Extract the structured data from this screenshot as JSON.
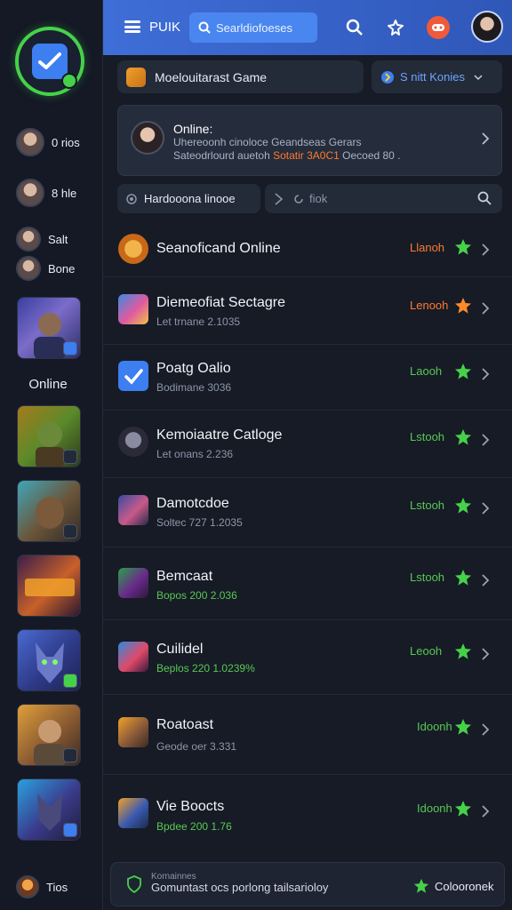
{
  "app": {
    "brand": "PUIK"
  },
  "colors": {
    "accent": "#3f6ed8",
    "online_green": "#46d14a",
    "live_orange": "#ff7a2e",
    "panel": "#232a38"
  },
  "search": {
    "placeholder": "Searldiofoeses"
  },
  "top_icons": [
    "search-icon",
    "puzzle-icon",
    "game-badge-icon"
  ],
  "sidebar": {
    "contacts": [
      {
        "label": "0 rios"
      },
      {
        "label": "8 hle"
      },
      {
        "label": "Salt"
      },
      {
        "label": "Bone"
      }
    ],
    "online_label": "Online",
    "footer_label": "Tios"
  },
  "filters": {
    "category": "Moelouitarast Game",
    "mode": "S nitt Konies",
    "secondary": "Hardooona linooe",
    "search_placeholder": "fiok"
  },
  "feature": {
    "title": "Online:",
    "desc": "Uhereoonh cinoloce Geandseas Gerars",
    "meta_prefix": "Sateodrlourd auetoh ",
    "meta_highlight": "Sotatir 3A0C1",
    "meta_suffix": " Oecoed 80 ."
  },
  "games": [
    {
      "title": "Seanoficand Online",
      "sub": "",
      "status": "Llanoh",
      "status_color": "#ff7a2e",
      "star_color": "#46d14a"
    },
    {
      "title": "Diemeofiat Sectagre",
      "sub": "Let trnane 2.1035",
      "status": "Lenooh",
      "status_color": "#ff7a2e",
      "star_color": "#ff8a2a"
    },
    {
      "title": "Poatg Oalio",
      "sub": "Bodimane 3036",
      "status": "Laooh",
      "status_color": "#59c853",
      "star_color": "#46d14a"
    },
    {
      "title": "Kemoiaatre Catloge",
      "sub": "Let onans 2.236",
      "status": "Lstooh",
      "status_color": "#59c853",
      "star_color": "#46d14a"
    },
    {
      "title": "Damotcdoe",
      "sub": "Soltec 727 1.2035",
      "status": "Lstooh",
      "status_color": "#59c853",
      "star_color": "#46d14a"
    },
    {
      "title": "Bemcaat",
      "sub": "Bopos 200 2.036",
      "status": "Lstooh",
      "status_color": "#59c853",
      "star_color": "#46d14a"
    },
    {
      "title": "Cuilidel",
      "sub": "Beplos 220 1.0239%",
      "status": "Leooh",
      "status_color": "#59c853",
      "star_color": "#46d14a"
    },
    {
      "title": "Roatoast",
      "sub": "Geode oer 3.331",
      "status": "Idoonh",
      "status_color": "#59c853",
      "star_color": "#46d14a"
    },
    {
      "title": "Vie Boocts",
      "sub": "Bpdee 200 1.76",
      "status": "Idoonh",
      "status_color": "#59c853",
      "star_color": "#46d14a"
    }
  ],
  "bottom": {
    "line1": "Kornainnes",
    "line2": "Gomuntast ocs porlong tailsarioloy",
    "action": "Colooronek"
  }
}
